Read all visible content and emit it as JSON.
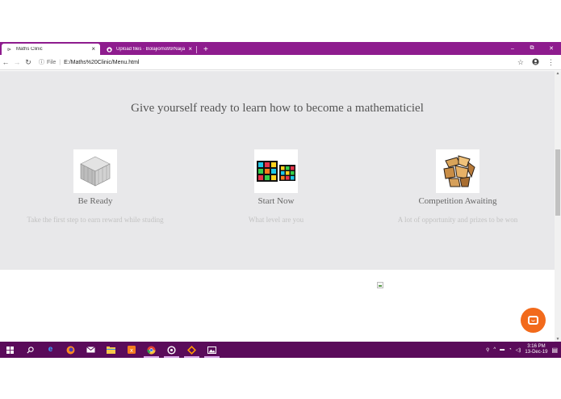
{
  "browser": {
    "tabs": [
      {
        "title": "Maths Clinic",
        "active": true
      },
      {
        "title": "Upload files · Bolajiomo99/Naija",
        "active": false
      }
    ],
    "new_tab": "+",
    "close_glyph": "×",
    "window_controls": {
      "minimize": "–",
      "maximize": "⧉",
      "close": "✕"
    },
    "address": {
      "scheme_label": "File",
      "url": "E:/Maths%20Clinic/Menu.html"
    }
  },
  "page": {
    "headline": "Give yourself ready to learn how to become a mathematiciel",
    "cards": [
      {
        "title": "Be Ready",
        "description": "Take the first step to earn reward while studing",
        "image": "silver-cube"
      },
      {
        "title": "Start Now",
        "description": "What level are you",
        "image": "neon-rubiks-cubes"
      },
      {
        "title": "Competition Awaiting",
        "description": "A lot of opportunity and prizes to be won",
        "image": "gold-mirror-cube"
      }
    ]
  },
  "taskbar": {
    "apps": [
      "windows-start",
      "search",
      "edge",
      "firefox",
      "mail",
      "file-explorer",
      "xampp",
      "chrome",
      "obs",
      "sublime",
      "photos"
    ],
    "clock_time": "3:16 PM",
    "clock_date": "13-Dec-19"
  },
  "colors": {
    "tab_bar": "#8e1c8e",
    "taskbar": "#5a0b5a",
    "hero_bg": "#e8e8ea",
    "chat_button": "#f26a1b"
  }
}
